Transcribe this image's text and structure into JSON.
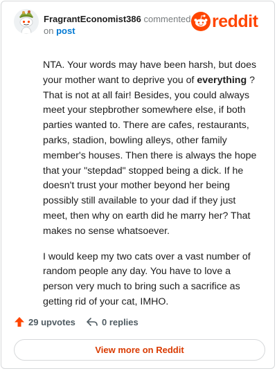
{
  "header": {
    "username": "FragrantEconomist386",
    "commented": "commented",
    "on": "on",
    "post_link": "post",
    "logo_text": "reddit",
    "brand_color": "#ff4500"
  },
  "comment": {
    "p1_before": "NTA. Your words may have been harsh, but does your mother want to deprive you of ",
    "p1_emphasis": "everything",
    "p1_after": " ? That is not at all fair! Besides, you could always meet your stepbrother somewhere else, if both parties wanted to. There are cafes, restaurants, parks, stadion, bowling alleys, other family member's houses. Then there is always the hope that your \"stepdad\" stopped being a dick. If he doesn't trust your mother beyond her being possibly still available to your dad if they just meet, then why on earth did he marry her? That makes no sense whatsoever.",
    "p2": "I would keep my two cats over a vast number of random people any day. You have to love a person very much to bring such a sacrifice as getting rid of your cat, IMHO."
  },
  "actions": {
    "upvotes": "29 upvotes",
    "replies": "0 replies",
    "upvote_icon": "upvote-arrow-icon",
    "reply_icon": "reply-arrow-icon"
  },
  "footer": {
    "view_more": "View more on Reddit"
  }
}
